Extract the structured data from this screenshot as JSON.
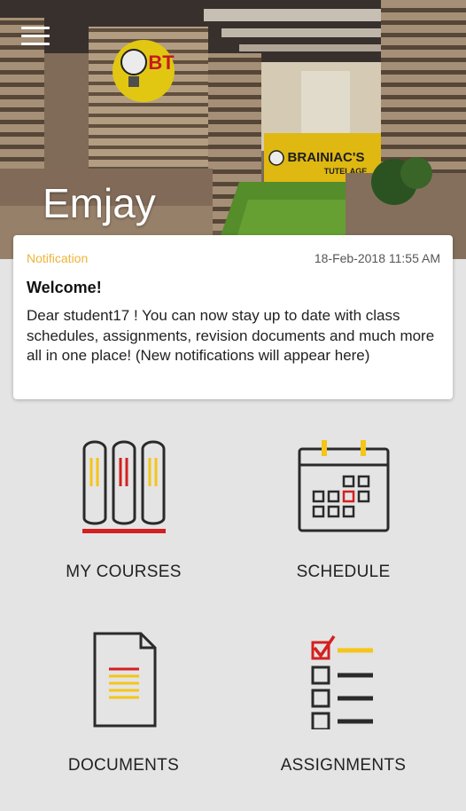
{
  "header": {
    "user_name": "Emjay",
    "logo_letters": "BT",
    "sign_text": "BRAINIAC'S",
    "sign_subtext": "TUTELAGE"
  },
  "notification": {
    "type_label": "Notification",
    "timestamp": "18-Feb-2018 11:55 AM",
    "title": "Welcome!",
    "body": "Dear student17 ! You can now stay up to date with class schedules, assignments, revision documents and much more all in one place! (New notifications will appear here)"
  },
  "tiles": [
    {
      "label": "MY COURSES",
      "icon": "books-icon"
    },
    {
      "label": "SCHEDULE",
      "icon": "calendar-icon"
    },
    {
      "label": "DOCUMENTS",
      "icon": "document-icon"
    },
    {
      "label": "ASSIGNMENTS",
      "icon": "checklist-icon"
    }
  ],
  "colors": {
    "accent_yellow": "#f5c518",
    "accent_red": "#d42020",
    "icon_dark": "#2a2a2a",
    "notification_label": "#f0b43a"
  }
}
